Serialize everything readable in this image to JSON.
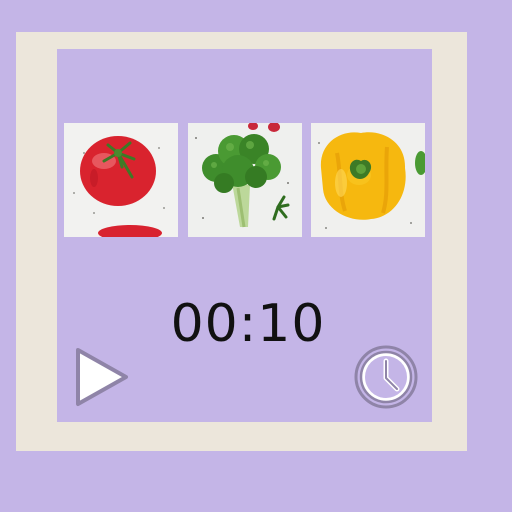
{
  "timer": {
    "display": "00:10"
  },
  "tiles": [
    {
      "name": "tomato-image"
    },
    {
      "name": "broccoli-image"
    },
    {
      "name": "yellow-pepper-image"
    }
  ],
  "controls": {
    "play_icon": "play-icon",
    "clock_icon": "clock-icon"
  },
  "colors": {
    "background": "#c4b5e7",
    "frame": "#ece6db",
    "icon_stroke": "#8f84a8",
    "icon_fill": "#ffffff"
  }
}
